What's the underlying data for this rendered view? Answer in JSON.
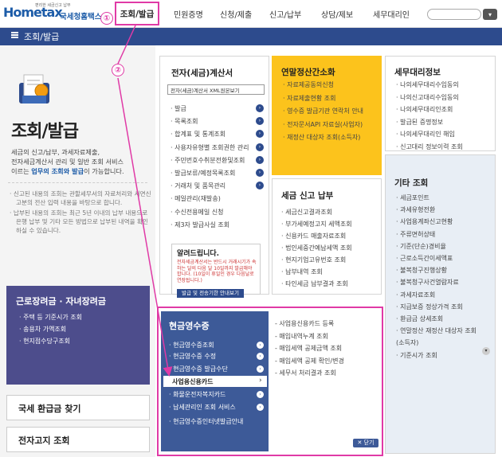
{
  "header": {
    "logo_main": "Hometax",
    "logo_sub": "국세청홈택스",
    "logo_tag": "편리한 세금신고 납부",
    "nav": [
      "조회/발급",
      "민원증명",
      "신청/제출",
      "신고/납부",
      "상담/제보",
      "세무대리인"
    ],
    "active_index": 0,
    "marker1": "①",
    "marker2": "②",
    "search_icon": "search-icon"
  },
  "breadcrumb_bar": {
    "title": "조회/발급",
    "menu_icon": "menu-icon"
  },
  "left": {
    "title": "조회/발급",
    "desc_1": "세금의 신고/납부, 과세자료제출,",
    "desc_2": "전자세금계산서 관리 및 일반 조회 서비스",
    "desc_3_pre": "이르는 ",
    "desc_3_hl": "업무의 조회와 발급",
    "desc_3_post": "이 가능합니다.",
    "notes": [
      "· 신고된 내용의 조회는 관할세무서의 자료처리와 서면신고분의 전산 입력 내용을 바탕으로 합니다.",
      "· 납부된 내용의 조회는 최근 5년 이내의 납부 내용으로 은행 납부 및 기타 모든 방법으로 납부된 내역을 확인하실 수 있습니다."
    ],
    "purple": {
      "title": "근로장려금 · 자녀장려금",
      "items": [
        "· 주택 등 기준시가 조회",
        "· 송용차 가액조회",
        "· 현지점수당구조회"
      ]
    },
    "btn_refund": "국세 환급금 찾기",
    "btn_notice": "전자고지 조회"
  },
  "ecard": {
    "title": "전자(세금)계산서",
    "input": "전자(세금)계산서 XML원본보기",
    "items": [
      "· 발급",
      "· 목록조회",
      "· 합계표 및 통계조회",
      "· 사용자유형별 조회권한 관리",
      "· 주민번호수취분전환및조회",
      "· 발급보류/예정목록조회",
      "· 거래처 및 품목관리",
      "· 메일관리(재발송)",
      "· 수신전용메일 신청",
      "· 제3자 발급사실 조회"
    ],
    "dot_rows": [
      0,
      1,
      2,
      3,
      4,
      5,
      6
    ],
    "alert": {
      "title": "알려드립니다.",
      "text": "전자세금계산서는 반드시 거래시기가 속하는 달의 다음 달 10일까지 발급해야 합니다. (10일이 휴일인 경우 다음날로 연장됩니다.)",
      "btn": "발급 및 전송기한 안내보기"
    }
  },
  "yellow": {
    "title": "연말정산간소화",
    "items": [
      "· 자료제공동의신청",
      "· 자료제출현황 조회",
      "· 영수증 발급기관 연락처 안내",
      "· 전자문서API 자료실(사업자)",
      "· 재정산 대상자 조회(소득자)"
    ]
  },
  "taxright": {
    "title": "세무대리정보",
    "items": [
      "· 나의세무대리수임동의",
      "· 나의신고대리수임동의",
      "· 나의세무대리인조회",
      "· 발급된 증명정보",
      "· 나의세무대리인 해임",
      "· 신고대리 정보이력 조회"
    ]
  },
  "taxreport": {
    "title": "세금 신고 납부",
    "items": [
      "· 세금신고결과조회",
      "· 부가세예정고지 세액조회",
      "· 신용카드 매출자료조회",
      "· 법인세중간예납세액 조회",
      "· 현지기업고유번호 조회",
      "· 납부내역 조회",
      "· 타인세금 납부결과 조회"
    ]
  },
  "other": {
    "title": "기타 조회",
    "items": [
      "· 세금포인트",
      "· 과세유형전환",
      "· 사업용계좌신고현황",
      "· 주류면허상태",
      "· 기준(단순)경비율",
      "· 근로소득간이세액표",
      "· 불복청구진행상황",
      "· 불복청구사건열람자료",
      "· 과세자료조회",
      "· 지급보증 정상가격 조회",
      "· 환급금 상세조회",
      "· 연말정산 재정산 대상자 조회",
      "  (소득자)",
      "· 기준시가 조회"
    ],
    "more_icon": "chevron-down-icon"
  },
  "cash": {
    "title": "현금영수증",
    "items": [
      "· 현금영수증조회",
      "· 현금영수증 수정",
      "· 현금영수증 발급수단",
      "사업용신용카드",
      "· 화물운전자복지카드",
      "· 납세관리인 조회 서비스",
      "· 현금영수증인터넷발급안내"
    ],
    "selected_index": 3,
    "dot_rows": [
      0,
      1,
      2,
      4,
      5
    ],
    "right_items": [
      "- 사업용신용카드 등록",
      "- 매입내역누계 조회",
      "- 매입세액 공제금액 조회",
      "- 매입세액 공제 확인/변경",
      "- 세무서 처리결과 조회"
    ],
    "close": "✕ 닫기"
  }
}
